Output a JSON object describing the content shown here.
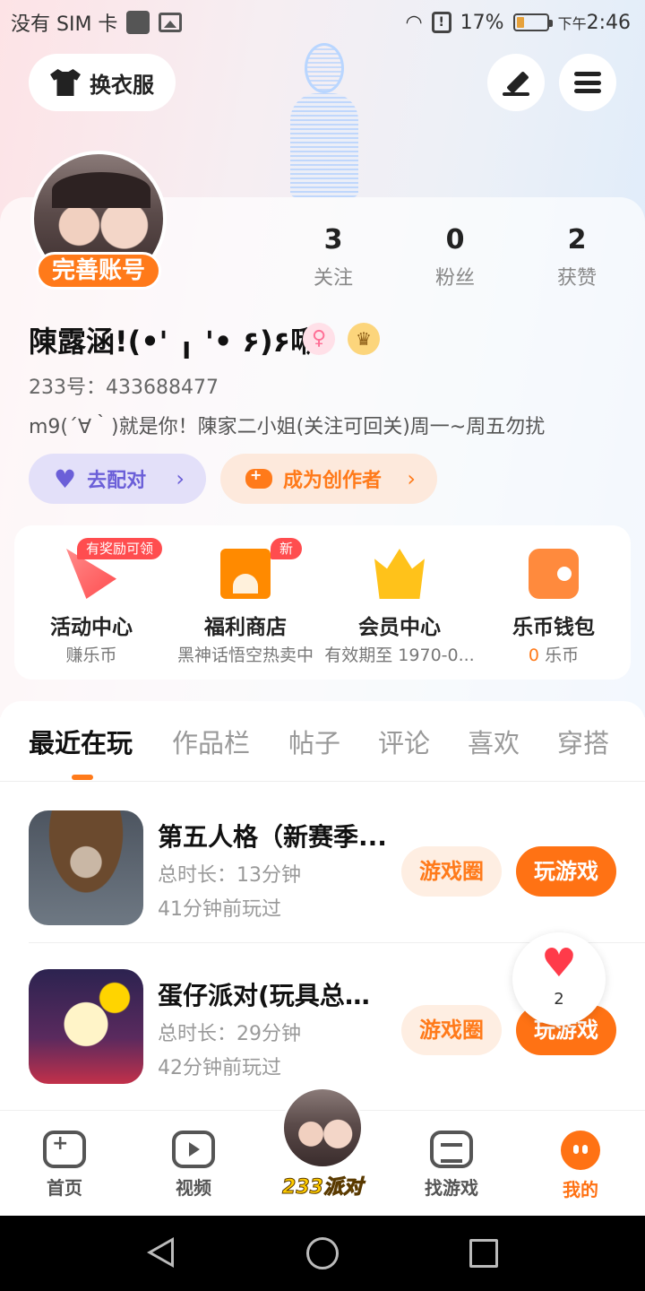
{
  "status_bar": {
    "carrier": "没有 SIM 卡",
    "battery": "17%",
    "time_prefix": "下午",
    "time": "2:46"
  },
  "header": {
    "outfit_button": "换衣服"
  },
  "profile": {
    "complete_badge": "完善账号",
    "stats": [
      {
        "value": "3",
        "label": "关注"
      },
      {
        "value": "0",
        "label": "粉丝"
      },
      {
        "value": "2",
        "label": "获赞"
      }
    ],
    "username": "陳露涵!(•' ╻ '• ۶)۶啾!",
    "gender_symbol": "♀",
    "crown_symbol": "♛",
    "uid": "233号：433688477",
    "bio": "m9(´∀｀)就是你！陳家二小姐(关注可回关)周一~周五勿扰",
    "match_button": "去配对",
    "creator_button": "成为创作者"
  },
  "features": [
    {
      "title": "活动中心",
      "subtitle": "赚乐币",
      "badge": "有奖励可领",
      "icon": "activity-icon"
    },
    {
      "title": "福利商店",
      "subtitle": "黑神话悟空热卖中",
      "badge": "新",
      "icon": "shop-icon"
    },
    {
      "title": "会员中心",
      "subtitle": "有效期至 1970-0...",
      "badge": "",
      "icon": "crown-icon"
    },
    {
      "title": "乐币钱包",
      "subtitle_value": "0",
      "subtitle_unit": "乐币",
      "badge": "",
      "icon": "wallet-icon"
    }
  ],
  "tabs": [
    "最近在玩",
    "作品栏",
    "帖子",
    "评论",
    "喜欢",
    "穿搭"
  ],
  "games": [
    {
      "title": "第五人格（新赛季...",
      "duration": "总时长：13分钟",
      "last_played": "41分钟前玩过",
      "circle_button": "游戏圈",
      "play_button": "玩游戏"
    },
    {
      "title": "蛋仔派对(玩具总动...",
      "duration": "总时长：29分钟",
      "last_played": "42分钟前玩过",
      "circle_button": "游戏圈",
      "play_button": "玩游戏"
    }
  ],
  "floating_like": {
    "count": "2"
  },
  "bottom_nav": {
    "home": "首页",
    "video": "视频",
    "center": "233派对",
    "find_games": "找游戏",
    "me": "我的"
  },
  "colors": {
    "accent": "#ff7214",
    "match_purple": "#6b5fd8",
    "badge_red": "#ff4d4f"
  }
}
